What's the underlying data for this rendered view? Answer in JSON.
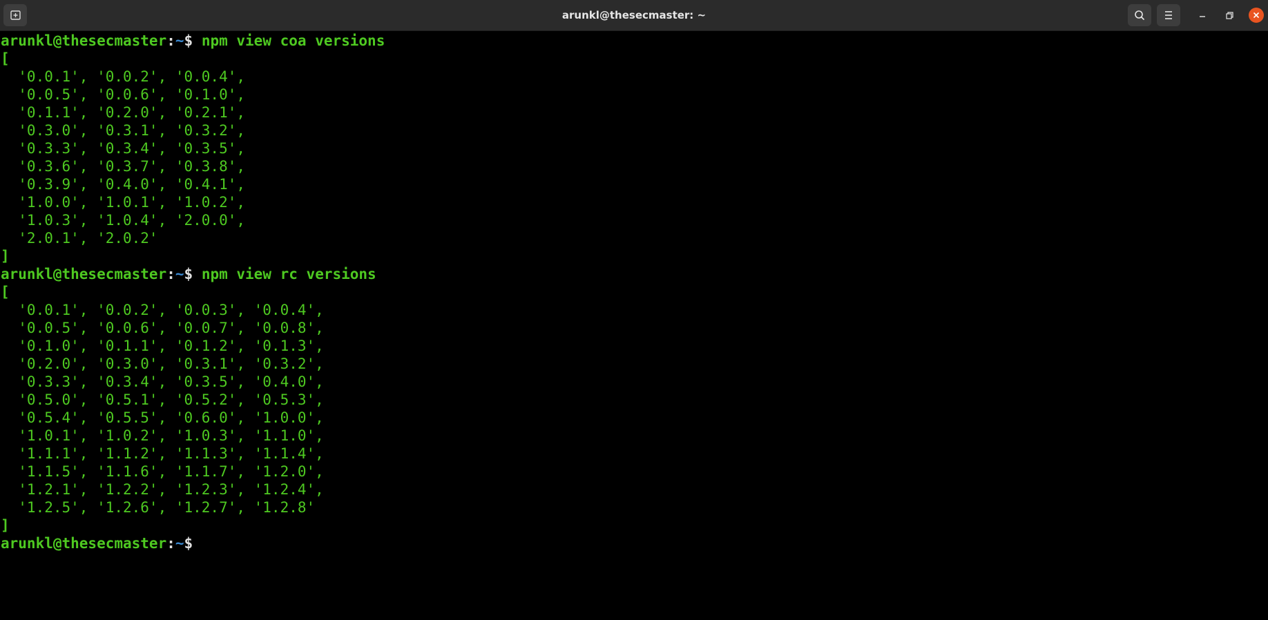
{
  "window": {
    "title": "arunkl@thesecmaster: ~"
  },
  "titlebar": {
    "new_tab_icon": "new-tab-icon",
    "search_icon": "search-icon",
    "menu_icon": "hamburger-menu-icon",
    "minimize_icon": "minimize-icon",
    "maximize_icon": "restore-icon",
    "close_icon": "close-icon",
    "close_color": "#e95420"
  },
  "prompt": {
    "user_host": "arunkl@thesecmaster",
    "separator": ":",
    "dir": "~",
    "symbol": "$ "
  },
  "colors": {
    "text_green": "#4ec921",
    "dir_blue": "#3a88d0",
    "background": "#000000",
    "titlebar": "#2b2b2b"
  },
  "blocks": [
    {
      "command": "npm view coa versions",
      "open": "[",
      "close": "]",
      "rows": [
        "  '0.0.1', '0.0.2', '0.0.4',",
        "  '0.0.5', '0.0.6', '0.1.0',",
        "  '0.1.1', '0.2.0', '0.2.1',",
        "  '0.3.0', '0.3.1', '0.3.2',",
        "  '0.3.3', '0.3.4', '0.3.5',",
        "  '0.3.6', '0.3.7', '0.3.8',",
        "  '0.3.9', '0.4.0', '0.4.1',",
        "  '1.0.0', '1.0.1', '1.0.2',",
        "  '1.0.3', '1.0.4', '2.0.0',",
        "  '2.0.1', '2.0.2'"
      ]
    },
    {
      "command": "npm view rc versions",
      "open": "[",
      "close": "]",
      "rows": [
        "  '0.0.1', '0.0.2', '0.0.3', '0.0.4',",
        "  '0.0.5', '0.0.6', '0.0.7', '0.0.8',",
        "  '0.1.0', '0.1.1', '0.1.2', '0.1.3',",
        "  '0.2.0', '0.3.0', '0.3.1', '0.3.2',",
        "  '0.3.3', '0.3.4', '0.3.5', '0.4.0',",
        "  '0.5.0', '0.5.1', '0.5.2', '0.5.3',",
        "  '0.5.4', '0.5.5', '0.6.0', '1.0.0',",
        "  '1.0.1', '1.0.2', '1.0.3', '1.1.0',",
        "  '1.1.1', '1.1.2', '1.1.3', '1.1.4',",
        "  '1.1.5', '1.1.6', '1.1.7', '1.2.0',",
        "  '1.2.1', '1.2.2', '1.2.3', '1.2.4',",
        "  '1.2.5', '1.2.6', '1.2.7', '1.2.8'"
      ]
    }
  ],
  "final_prompt": {
    "command": ""
  }
}
